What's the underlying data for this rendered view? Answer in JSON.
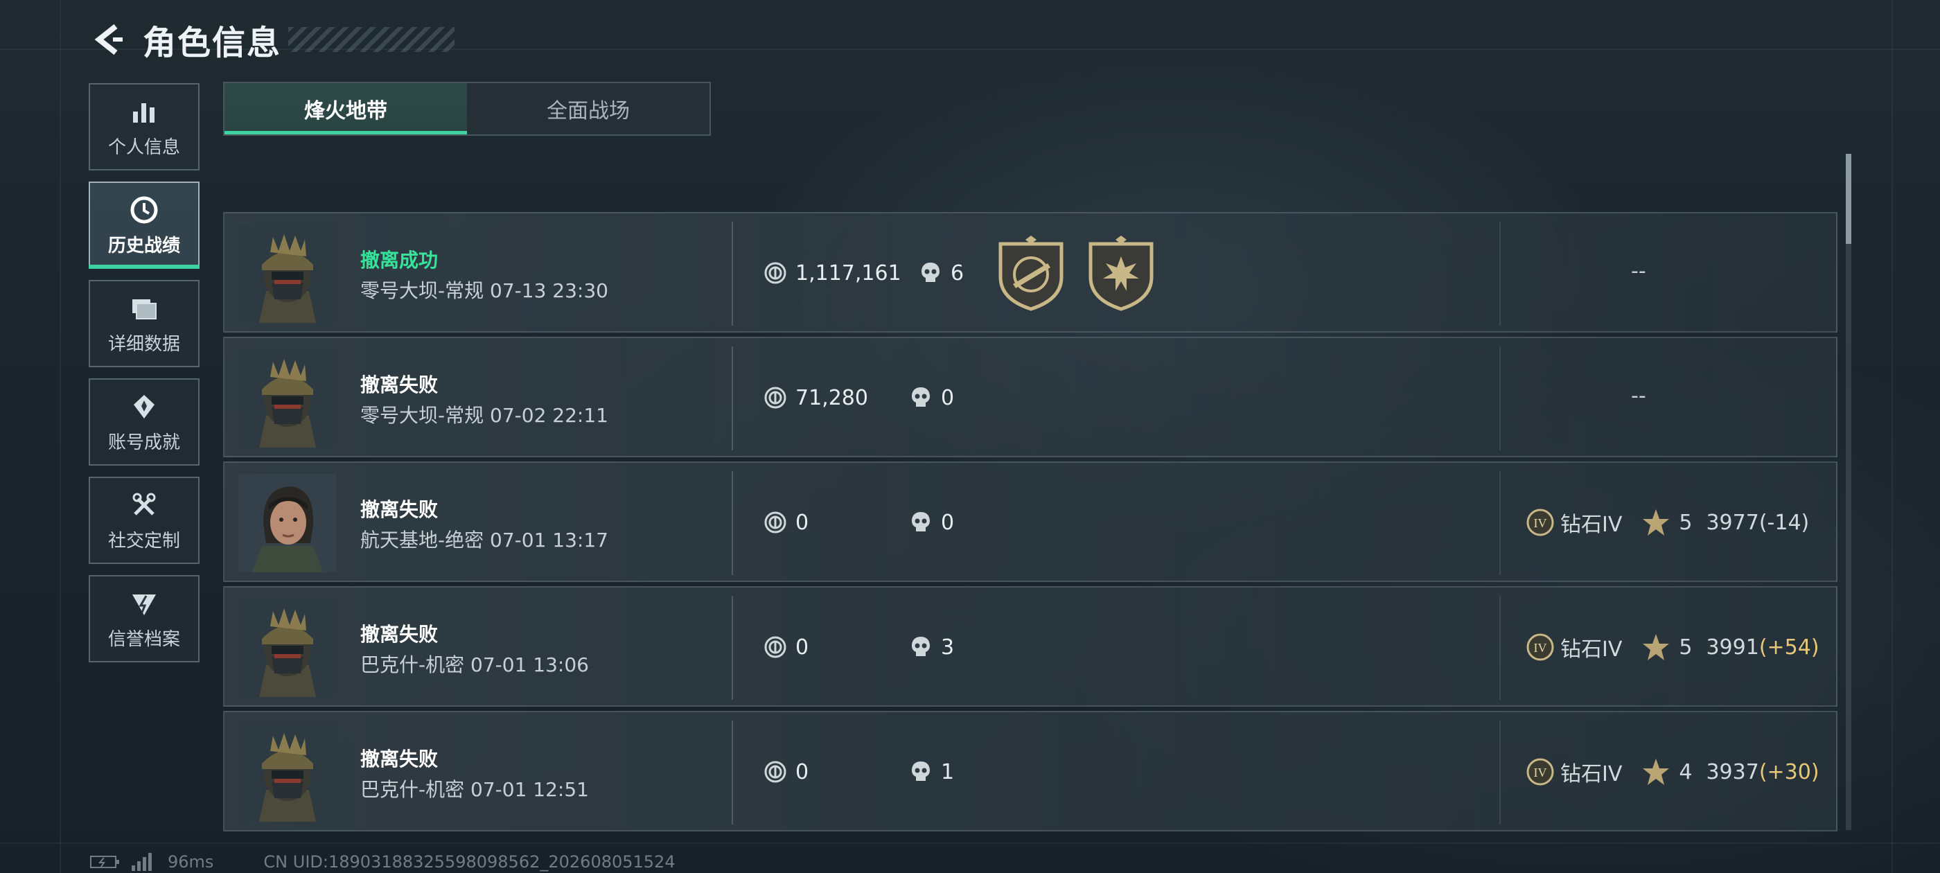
{
  "header": {
    "title": "角色信息",
    "back_icon": "back-arrow-icon"
  },
  "side_menu": [
    {
      "label": "个人信息",
      "icon": "bar-chart-icon",
      "active": false
    },
    {
      "label": "历史战绩",
      "icon": "history-clock-icon",
      "active": true
    },
    {
      "label": "详细数据",
      "icon": "folder-icon",
      "active": false
    },
    {
      "label": "账号成就",
      "icon": "achievement-icon",
      "active": false
    },
    {
      "label": "社交定制",
      "icon": "wrench-icon",
      "active": false
    },
    {
      "label": "信誉档案",
      "icon": "reputation-icon",
      "active": false
    }
  ],
  "tabs": [
    {
      "label": "烽火地带",
      "active": true
    },
    {
      "label": "全面战场",
      "active": false
    }
  ],
  "records": [
    {
      "result": "撤离成功",
      "success": true,
      "map": "零号大坝-常规",
      "time": "07-13 23:30",
      "value": "1,117,161",
      "kills": "6",
      "medals": [
        "rifle-medal-icon",
        "explosion-medal-icon"
      ],
      "rank": "--"
    },
    {
      "result": "撤离失败",
      "success": false,
      "map": "零号大坝-常规",
      "time": "07-02 22:11",
      "value": "71,280",
      "kills": "0",
      "medals": [],
      "rank": "--"
    },
    {
      "result": "撤离失败",
      "success": false,
      "map": "航天基地-绝密",
      "time": "07-01 13:17",
      "value": "0",
      "kills": "0",
      "medals": [],
      "tier": "钻石IV",
      "stars": "5",
      "score": "3977",
      "delta": "(-14)",
      "delta_up": false
    },
    {
      "result": "撤离失败",
      "success": false,
      "map": "巴克什-机密",
      "time": "07-01 13:06",
      "value": "0",
      "kills": "3",
      "medals": [],
      "tier": "钻石IV",
      "stars": "5",
      "score": "3991",
      "delta": "(+54)",
      "delta_up": true
    },
    {
      "result": "撤离失败",
      "success": false,
      "map": "巴克什-机密",
      "time": "07-01 12:51",
      "value": "0",
      "kills": "1",
      "medals": [],
      "tier": "钻石IV",
      "stars": "4",
      "score": "3937",
      "delta": "(+30)",
      "delta_up": true
    }
  ],
  "footer": {
    "ping": "96ms",
    "uid": "CN UID:18903188325598098562_202608051524"
  },
  "colors": {
    "accent": "#3fd3a2",
    "success": "#37e39a",
    "gold": "#e8c77a"
  }
}
